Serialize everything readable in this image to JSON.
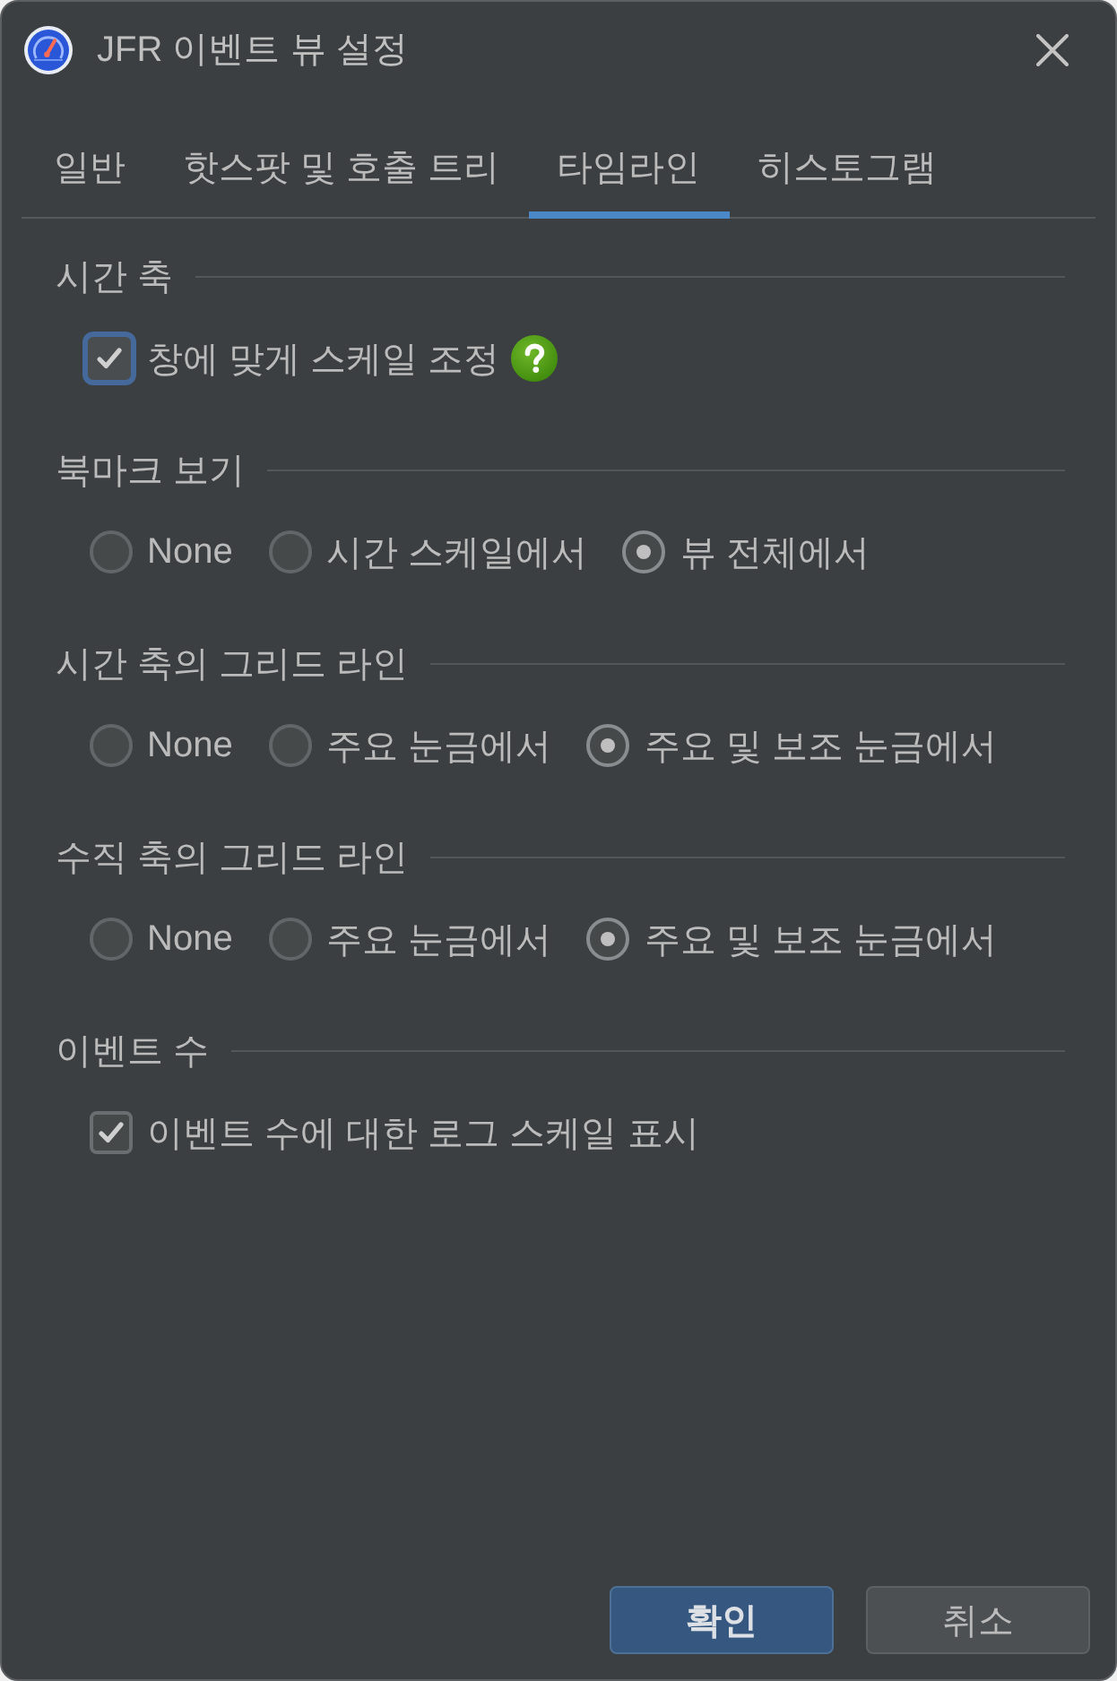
{
  "window": {
    "title": "JFR 이벤트 뷰 설정"
  },
  "tabs": [
    {
      "label": "일반",
      "selected": false
    },
    {
      "label": "핫스팟 및 호출 트리",
      "selected": false
    },
    {
      "label": "타임라인",
      "selected": true
    },
    {
      "label": "히스토그램",
      "selected": false
    }
  ],
  "sections": [
    {
      "title": "시간 축",
      "options": [
        {
          "kind": "checkbox",
          "label": "창에 맞게 스케일 조정",
          "checked": true,
          "focused": true,
          "help": true
        }
      ]
    },
    {
      "title": "북마크 보기",
      "options": [
        {
          "kind": "radio",
          "label": "None",
          "selected": false
        },
        {
          "kind": "radio",
          "label": "시간 스케일에서",
          "selected": false
        },
        {
          "kind": "radio",
          "label": "뷰 전체에서",
          "selected": true
        }
      ]
    },
    {
      "title": "시간 축의 그리드 라인",
      "options": [
        {
          "kind": "radio",
          "label": "None",
          "selected": false
        },
        {
          "kind": "radio",
          "label": "주요 눈금에서",
          "selected": false
        },
        {
          "kind": "radio",
          "label": "주요 및 보조 눈금에서",
          "selected": true
        }
      ]
    },
    {
      "title": "수직 축의 그리드 라인",
      "options": [
        {
          "kind": "radio",
          "label": "None",
          "selected": false
        },
        {
          "kind": "radio",
          "label": "주요 눈금에서",
          "selected": false
        },
        {
          "kind": "radio",
          "label": "주요 및 보조 눈금에서",
          "selected": true
        }
      ]
    },
    {
      "title": "이벤트 수",
      "options": [
        {
          "kind": "checkbox",
          "label": "이벤트 수에 대한 로그 스케일 표시",
          "checked": true
        }
      ]
    }
  ],
  "buttons": [
    {
      "label": "확인",
      "kind": "primary"
    },
    {
      "label": "취소",
      "kind": "secondary"
    }
  ]
}
